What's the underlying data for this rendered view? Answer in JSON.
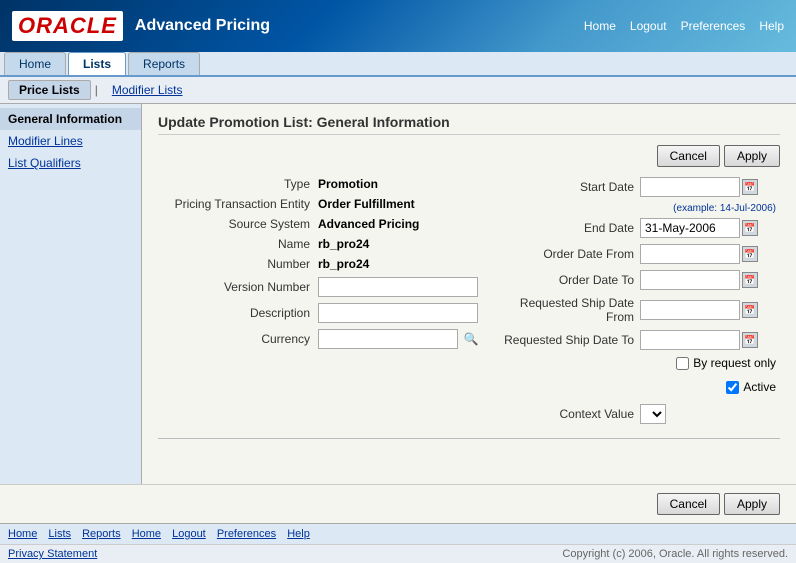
{
  "header": {
    "logo": "ORACLE",
    "app_title": "Advanced Pricing",
    "nav": [
      "Home",
      "Logout",
      "Preferences",
      "Help"
    ]
  },
  "tabs": [
    {
      "label": "Home",
      "active": false
    },
    {
      "label": "Lists",
      "active": true
    },
    {
      "label": "Reports",
      "active": false
    }
  ],
  "subtabs": [
    {
      "label": "Price Lists",
      "active": true
    },
    {
      "label": "Modifier Lists",
      "active": false
    }
  ],
  "sidebar": {
    "items": [
      {
        "label": "General Information",
        "active": true
      },
      {
        "label": "Modifier Lines",
        "active": false
      },
      {
        "label": "List Qualifiers",
        "active": false
      }
    ]
  },
  "page": {
    "title": "Update Promotion List: General Information",
    "type_label": "Type",
    "type_value": "Promotion",
    "pricing_entity_label": "Pricing Transaction Entity",
    "pricing_entity_value": "Order Fulfillment",
    "source_system_label": "Source System",
    "source_system_value": "Advanced Pricing",
    "name_label": "Name",
    "name_value": "rb_pro24",
    "number_label": "Number",
    "number_value": "rb_pro24",
    "version_label": "Version Number",
    "description_label": "Description",
    "currency_label": "Currency",
    "start_date_label": "Start Date",
    "start_date_value": "",
    "start_date_example": "(example: 14-Jul-2006)",
    "end_date_label": "End Date",
    "end_date_value": "31-May-2006",
    "order_date_from_label": "Order Date From",
    "order_date_to_label": "Order Date To",
    "req_ship_from_label": "Requested Ship Date From",
    "req_ship_to_label": "Requested Ship Date To",
    "by_request_label": "By request only",
    "active_label": "Active",
    "active_checked": true,
    "by_request_checked": false,
    "context_value_label": "Context Value",
    "cancel_label": "Cancel",
    "apply_label": "Apply"
  },
  "footer": {
    "links": [
      "Home",
      "Lists",
      "Reports",
      "Home",
      "Logout",
      "Preferences",
      "Help"
    ],
    "privacy": "Privacy Statement",
    "copyright": "Copyright (c) 2006, Oracle. All rights reserved."
  }
}
